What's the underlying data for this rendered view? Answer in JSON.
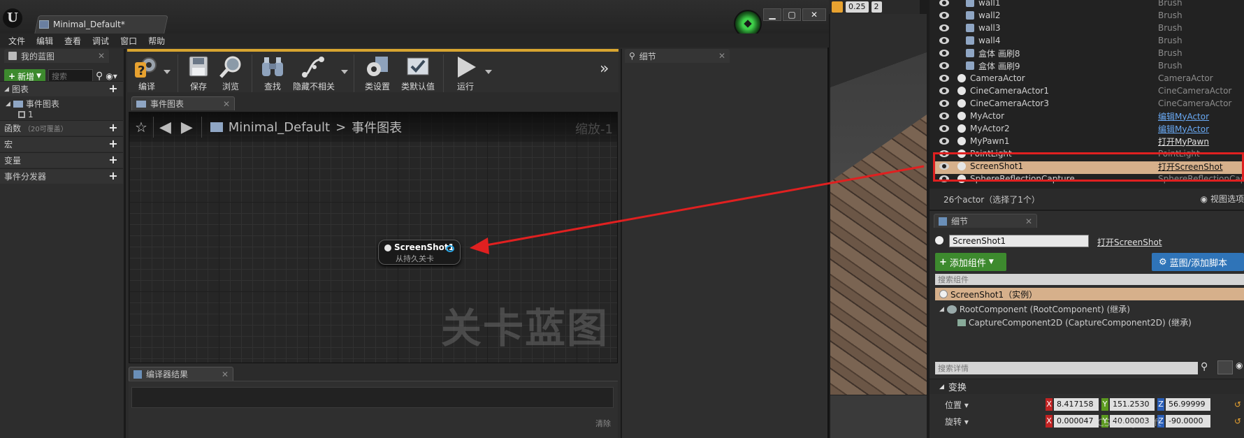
{
  "window": {
    "doc_tab": "Minimal_Default*",
    "minimize": "▁",
    "maximize": "▢",
    "close": "✕"
  },
  "menu": [
    "文件",
    "编辑",
    "查看",
    "调试",
    "窗口",
    "帮助"
  ],
  "scene_toolbar": {
    "snap_value": "0.25",
    "cam_speed": "2"
  },
  "my_blueprint": {
    "tab": "我的蓝图",
    "new_button": "新增",
    "search_placeholder": "搜索",
    "sections": [
      {
        "label": "图表",
        "sub": ""
      },
      {
        "label": "函数",
        "sub": "（20可覆盖）"
      },
      {
        "label": "宏",
        "sub": ""
      },
      {
        "label": "变量",
        "sub": ""
      },
      {
        "label": "事件分发器",
        "sub": ""
      }
    ],
    "graph_item": "事件图表",
    "graph_child": "1"
  },
  "toolbar": {
    "compile": "编译",
    "save": "保存",
    "browse": "浏览",
    "find": "查找",
    "hide_unrelated": "隐藏不相关",
    "class_settings": "类设置",
    "class_defaults": "类默认值",
    "run": "运行",
    "more": "»"
  },
  "graph": {
    "tab": "事件图表",
    "breadcrumb_root": "Minimal_Default",
    "breadcrumb_sep": ">",
    "breadcrumb_leaf": "事件图表",
    "zoom": "缩放-1",
    "watermark": "关卡蓝图",
    "node_title": "ScreenShot1",
    "node_subtitle": "从持久关卡"
  },
  "compiler": {
    "tab": "编译器结果",
    "clear": "清除"
  },
  "details_tab": "细节",
  "outliner": {
    "rows": [
      {
        "label": "wall1",
        "type": "Brush",
        "style": "plain"
      },
      {
        "label": "wall2",
        "type": "Brush",
        "style": "plain"
      },
      {
        "label": "wall3",
        "type": "Brush",
        "style": "plain"
      },
      {
        "label": "wall4",
        "type": "Brush",
        "style": "plain"
      },
      {
        "label": "盒体 画刷8",
        "type": "Brush",
        "style": "plain"
      },
      {
        "label": "盒体 画刷9",
        "type": "Brush",
        "style": "plain"
      },
      {
        "label": "CameraActor",
        "type": "CameraActor",
        "style": "plain"
      },
      {
        "label": "CineCameraActor1",
        "type": "CineCameraActor",
        "style": "plain"
      },
      {
        "label": "CineCameraActor3",
        "type": "CineCameraActor",
        "style": "plain"
      },
      {
        "label": "MyActor",
        "type": "编辑MyActor",
        "style": "link"
      },
      {
        "label": "MyActor2",
        "type": "编辑MyActor",
        "style": "link"
      },
      {
        "label": "MyPawn1",
        "type": "打开MyPawn",
        "style": "open"
      },
      {
        "label": "PointLight",
        "type": "PointLight",
        "style": "plain"
      },
      {
        "label": "ScreenShot1",
        "type": "打开ScreenShot",
        "style": "open"
      },
      {
        "label": "SphereReflectionCapture",
        "type": "SphereReflectionCapture",
        "style": "plain"
      }
    ],
    "footer": "26个actor（选择了1个）",
    "view_options": "视图选项"
  },
  "actor_details": {
    "tab": "细节",
    "name_value": "ScreenShot1",
    "open_link": "打开ScreenShot",
    "add_component": "添加组件",
    "blueprint_script": "蓝图/添加脚本",
    "component_search_placeholder": "搜索组件",
    "self_row": "ScreenShot1（实例）",
    "components": [
      "RootComponent (RootComponent) (继承)",
      "CaptureComponent2D (CaptureComponent2D) (继承)"
    ],
    "detail_search_placeholder": "搜索详情",
    "transform": "变换",
    "location_label": "位置",
    "rotation_label": "旋转",
    "location": {
      "x": "8.417158",
      "y": "151.2530",
      "z": "56.99999"
    },
    "rotation": {
      "x": "0.000047",
      "y": "40.00003",
      "z": "-90.0000"
    }
  },
  "watermark_text": "CSDN @lcwft",
  "colors": {
    "accent_orange": "#d8a530",
    "selection": "#d6b08b",
    "add_green": "#3d8a2e",
    "script_blue": "#2f74b8",
    "annotation_red": "#e02020"
  }
}
